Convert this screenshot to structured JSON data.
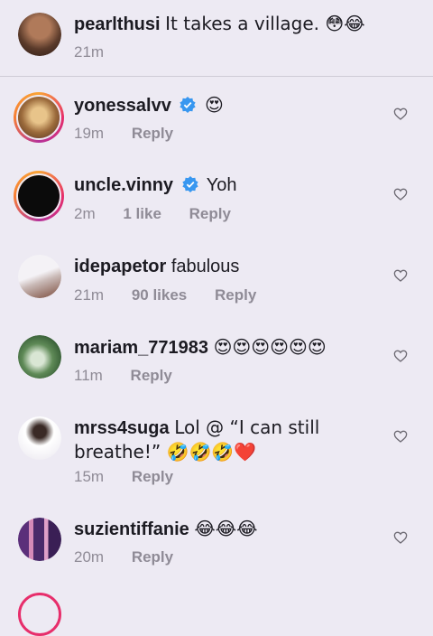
{
  "caption": {
    "username": "pearlthusi",
    "text": "It takes a village. 😳😂",
    "time": "21m"
  },
  "comments": [
    {
      "username": "yonessalvv",
      "verified": true,
      "text": "😍",
      "time": "19m",
      "likes": "",
      "reply": "Reply"
    },
    {
      "username": "uncle.vinny",
      "verified": true,
      "text": "Yoh",
      "time": "2m",
      "likes": "1 like",
      "reply": "Reply"
    },
    {
      "username": "idepapetor",
      "verified": false,
      "text": "fabulous",
      "time": "21m",
      "likes": "90 likes",
      "reply": "Reply"
    },
    {
      "username": "mariam_771983",
      "verified": false,
      "text": "😍😍😍😍😍😍",
      "time": "11m",
      "likes": "",
      "reply": "Reply"
    },
    {
      "username": "mrss4suga",
      "verified": false,
      "text": "Lol @ “I can still breathe!” 🤣🤣🤣❤️",
      "time": "15m",
      "likes": "",
      "reply": "Reply"
    },
    {
      "username": "suzientiffanie",
      "verified": false,
      "text": "😂😂😂",
      "time": "20m",
      "likes": "",
      "reply": "Reply"
    }
  ],
  "icons": {
    "verified": "verified-badge-icon",
    "like": "heart-outline-icon"
  },
  "colors": {
    "background": "#edeaf3",
    "verified": "#3897f0",
    "story_ring": "#e72e6b",
    "meta_text": "#8f8b96"
  }
}
